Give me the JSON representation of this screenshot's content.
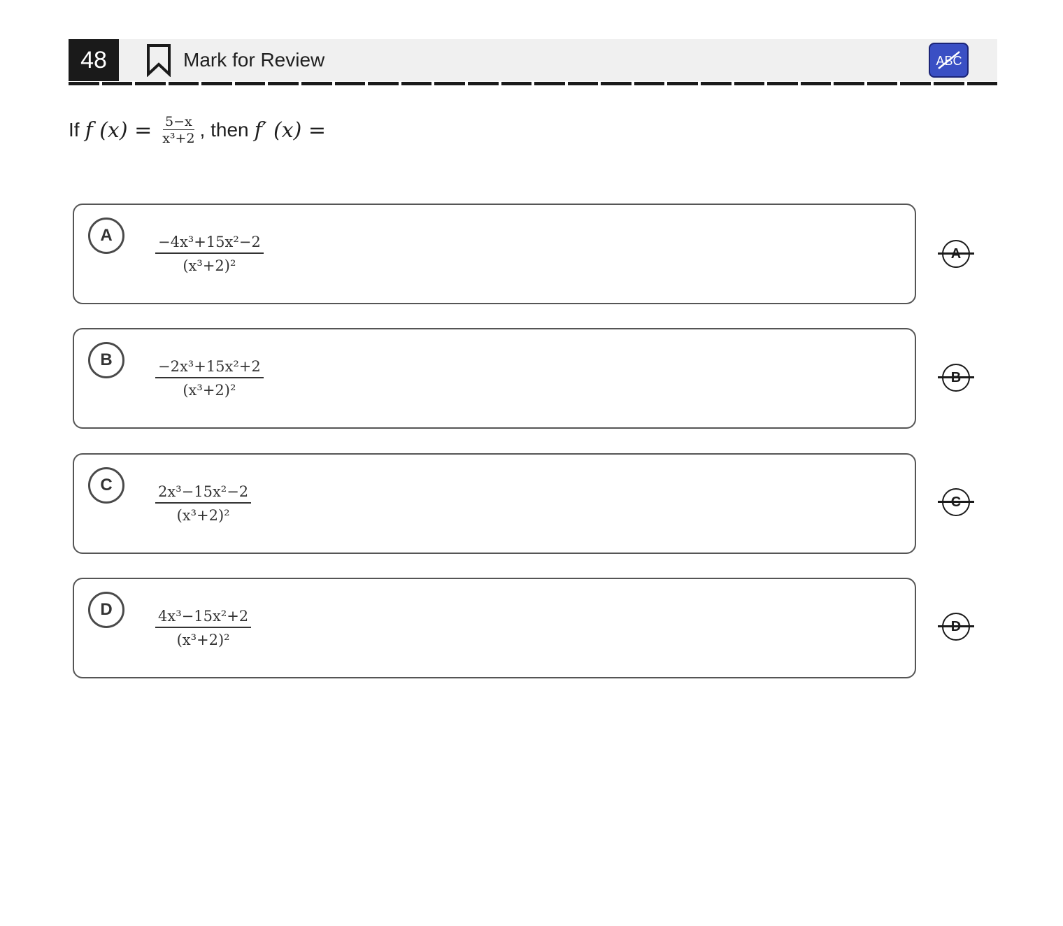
{
  "header": {
    "question_number": "48",
    "mark_label": "Mark for Review",
    "abc_button": "ABC"
  },
  "question": {
    "prefix": "If",
    "f_lhs": "f (x) =",
    "num": "5−x",
    "den": "x³+2",
    "mid": ", then",
    "fprime_lhs": "f′ (x) ="
  },
  "choices": [
    {
      "letter": "A",
      "num": "−4x³+15x²−2",
      "den": "(x³+2)²"
    },
    {
      "letter": "B",
      "num": "−2x³+15x²+2",
      "den": "(x³+2)²"
    },
    {
      "letter": "C",
      "num": "2x³−15x²−2",
      "den": "(x³+2)²"
    },
    {
      "letter": "D",
      "num": "4x³−15x²+2",
      "den": "(x³+2)²"
    }
  ],
  "colors": {
    "header_bg": "#f0f0f0",
    "number_bg": "#1a1a1a",
    "abc_bg": "#3a4fc4",
    "border": "#555555"
  }
}
